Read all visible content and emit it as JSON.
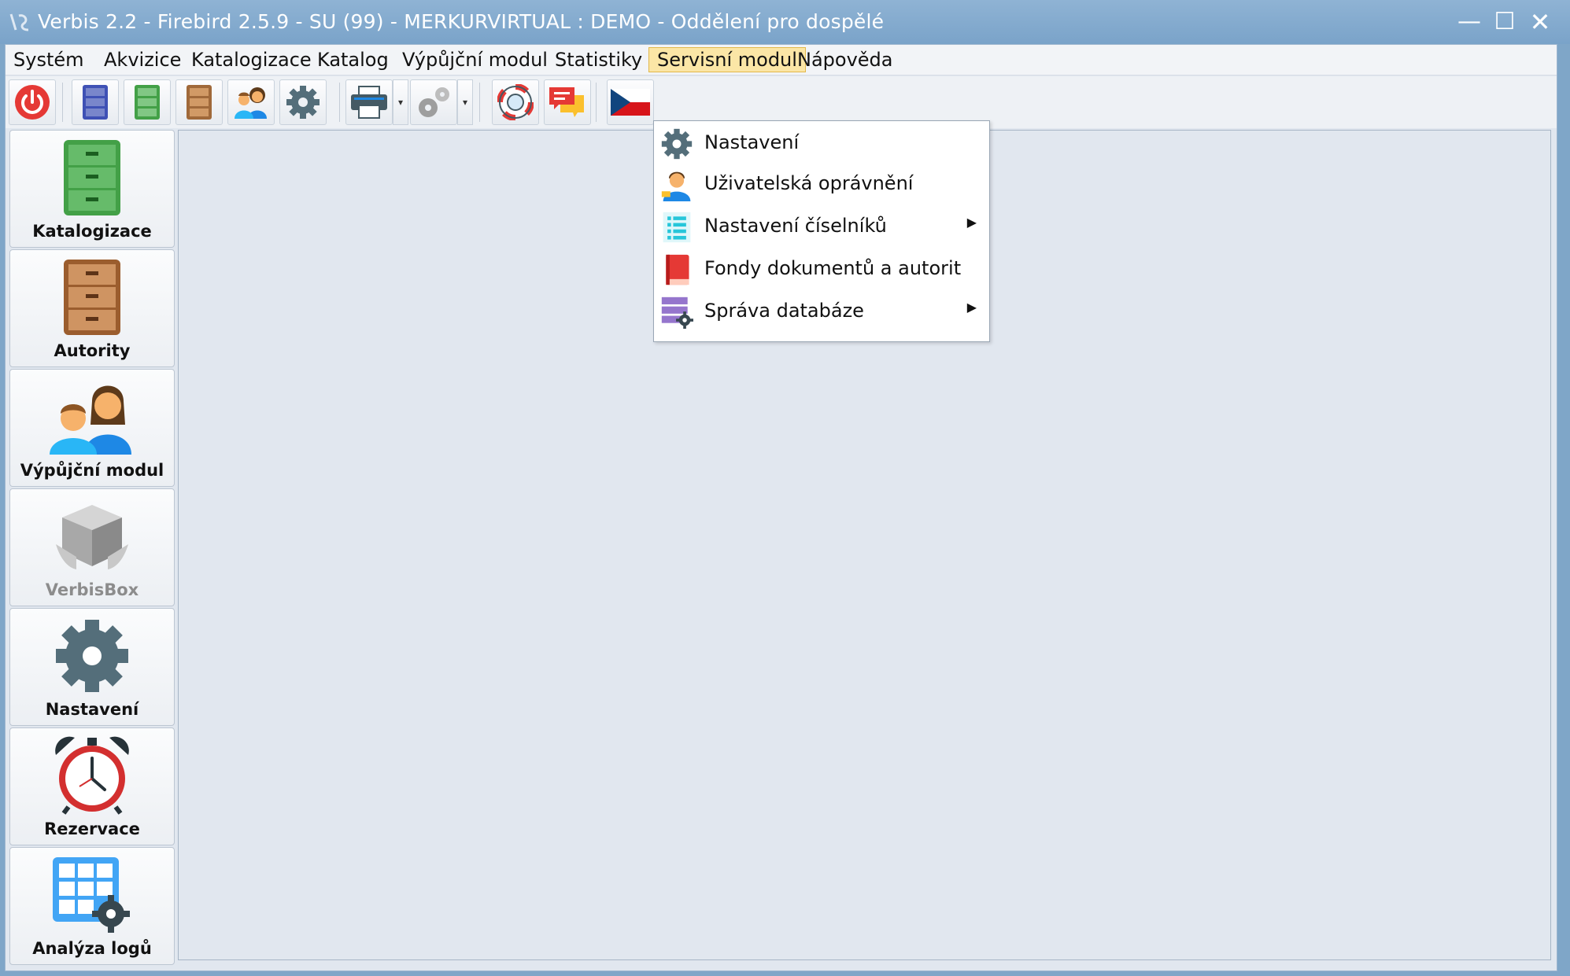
{
  "window": {
    "title": "Verbis 2.2 - Firebird 2.5.9 - SU (99) - MERKURVIRTUAL : DEMO - Oddělení pro dospělé",
    "minimize": "—",
    "maximize": "☐",
    "close": "✕"
  },
  "menubar": {
    "items": [
      "Systém",
      "Akvizice",
      "Katalogizace",
      "Katalog",
      "Výpůjční modul",
      "Statistiky",
      "Servisní modul",
      "Nápověda"
    ],
    "active": "Servisní modul"
  },
  "toolbar": {
    "buttons": [
      "power-icon",
      "blue-cabinet-icon",
      "green-cabinet-icon",
      "brown-cabinet-icon",
      "users-icon",
      "gear-icon",
      "printer-icon",
      "gears-icon",
      "lifebuoy-icon",
      "chat-icon",
      "czech-flag-icon"
    ],
    "dropdown_glyph": "▾"
  },
  "nav": {
    "items": [
      {
        "label": "Katalogizace",
        "icon": "green-cabinet-icon",
        "enabled": true
      },
      {
        "label": "Autority",
        "icon": "brown-cabinet-icon",
        "enabled": true
      },
      {
        "label": "Výpůjční modul",
        "icon": "users-icon",
        "enabled": true
      },
      {
        "label": "VerbisBox",
        "icon": "box-icon",
        "enabled": false
      },
      {
        "label": "Nastavení",
        "icon": "gear-icon",
        "enabled": true
      },
      {
        "label": "Rezervace",
        "icon": "alarm-clock-icon",
        "enabled": true
      },
      {
        "label": "Analýza logů",
        "icon": "grid-gear-icon",
        "enabled": true
      }
    ]
  },
  "dropdown": {
    "items": [
      {
        "label": "Nastavení",
        "icon": "gear-icon",
        "submenu": false
      },
      {
        "label": "Uživatelská oprávnění",
        "icon": "user-icon",
        "submenu": false
      },
      {
        "label": "Nastavení číselníků",
        "icon": "list-icon",
        "submenu": true
      },
      {
        "label": "Fondy dokumentů a autorit",
        "icon": "book-icon",
        "submenu": false
      },
      {
        "label": "Správa databáze",
        "icon": "database-gear-icon",
        "submenu": true
      }
    ],
    "submenu_arrow": "▶"
  },
  "colors": {
    "titlebar": "#7fa6c8",
    "menu_active": "#fbe6a6",
    "workspace": "#e1e7ef"
  }
}
